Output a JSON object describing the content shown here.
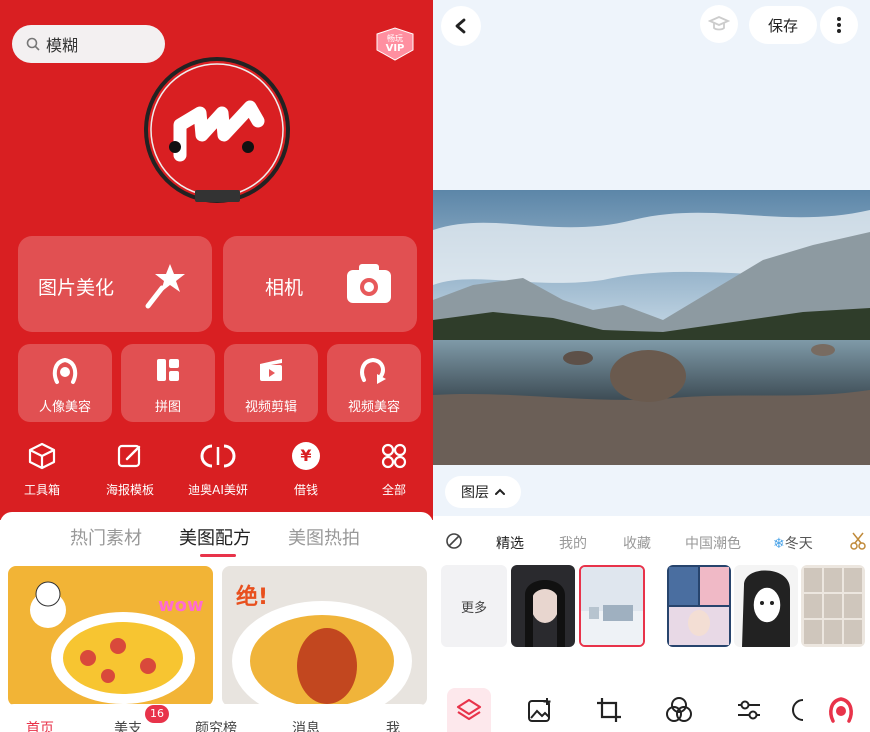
{
  "search": {
    "placeholder_text": "模糊"
  },
  "vip_badge": {
    "top": "畅玩",
    "bottom": "VIP"
  },
  "big_cards": [
    {
      "label": "图片美化",
      "icon": "magic-wand-icon"
    },
    {
      "label": "相机",
      "icon": "camera-icon"
    }
  ],
  "small_cards": [
    {
      "label": "人像美容",
      "icon": "face-icon"
    },
    {
      "label": "拼图",
      "icon": "collage-icon"
    },
    {
      "label": "视频剪辑",
      "icon": "clapper-icon"
    },
    {
      "label": "视频美容",
      "icon": "video-face-icon"
    }
  ],
  "tools": [
    {
      "label": "工具箱",
      "icon": "box-icon"
    },
    {
      "label": "海报模板",
      "icon": "edit-icon"
    },
    {
      "label": "迪奥AI美妍",
      "icon": "dior-icon"
    },
    {
      "label": "借钱",
      "icon": "yen-icon",
      "glyph": "¥"
    },
    {
      "label": "全部",
      "icon": "grid-icon"
    }
  ],
  "feed_tabs": [
    {
      "label": "热门素材",
      "active": false
    },
    {
      "label": "美图配方",
      "active": true
    },
    {
      "label": "美图热拍",
      "active": false
    }
  ],
  "feed_cards": [
    {
      "sticker": "wow",
      "desc": "chef-cartoon food bowl"
    },
    {
      "sticker": "绝!",
      "desc": "curry rice plate"
    }
  ],
  "bottom_nav": [
    {
      "label": "首页",
      "active": true
    },
    {
      "label": "美支",
      "active": false
    },
    {
      "label": "颜究榜",
      "active": false
    },
    {
      "label": "消息",
      "active": false
    },
    {
      "label": "我",
      "active": false
    }
  ],
  "nav_badge": "16",
  "editor": {
    "save_label": "保存",
    "layer_label": "图层"
  },
  "filter_tabs": [
    {
      "label": "精选",
      "active": true
    },
    {
      "label": "我的",
      "active": false
    },
    {
      "label": "收藏",
      "active": false
    },
    {
      "label": "中国潮色",
      "active": false
    },
    {
      "label": "冬天",
      "active": false
    }
  ],
  "more_label": "更多",
  "colors": {
    "brand_red": "#d91f22",
    "accent_pink": "#e8334a"
  }
}
